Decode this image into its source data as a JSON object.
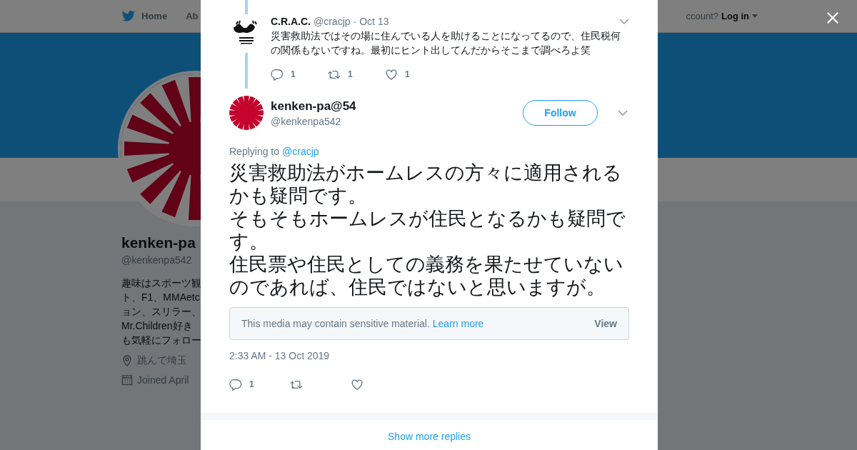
{
  "nav": {
    "home": "Home",
    "about": "Ab",
    "account_prompt": "ccount?",
    "login": "Log in"
  },
  "profile": {
    "name": "kenken-pa",
    "handle": "@kenkenpa542",
    "bio_lines": [
      "趣味はスポーツ観",
      "ト、F1、MMAetc",
      "ョン、スリラー、",
      "Mr.Children好き",
      "も気軽にフォロー"
    ],
    "location": "跳んで埼玉",
    "joined": "Joined April"
  },
  "parent_tweet": {
    "name": "C.R.A.C.",
    "handle": "@cracjp",
    "separator": "·",
    "date": "Oct 13",
    "text": "災害救助法ではその場に住んでいる人を助けることになってるので、住民税何の関係もないですね。最初にヒント出してんだからそこまで調べろよ笑",
    "actions": [
      {
        "kind": "reply",
        "count": "1"
      },
      {
        "kind": "retweet",
        "count": "1"
      },
      {
        "kind": "like",
        "count": "1"
      }
    ]
  },
  "tweet": {
    "name": "kenken-pa@54",
    "handle": "@kenkenpa542",
    "follow": "Follow",
    "replying_label": "Replying to",
    "replying_to": "@cracjp",
    "paragraphs": [
      "災害救助法がホームレスの方々に適用されるかも疑問です。",
      "そもそもホームレスが住民となるかも疑問です。",
      "住民票や住民としての義務を果たせていないのであれば、住民ではないと思いますが。"
    ],
    "sensitive": {
      "text": "This media may contain sensitive material.",
      "link": "Learn more",
      "button": "View"
    },
    "timestamp": "2:33 AM - 13 Oct 2019",
    "actions": [
      {
        "kind": "reply",
        "count": "1"
      },
      {
        "kind": "retweet"
      },
      {
        "kind": "like"
      }
    ]
  },
  "show_more": "Show more replies"
}
